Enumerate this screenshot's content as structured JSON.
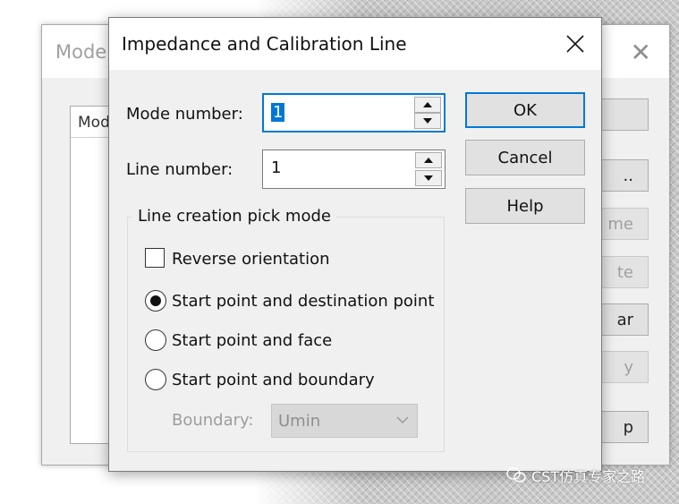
{
  "back_dialog": {
    "title_partial": "Mode",
    "list_header_partial": "Mod",
    "buttons": [
      "",
      "..",
      "me",
      "te",
      "ar",
      "y",
      "p"
    ]
  },
  "dialog": {
    "title": "Impedance and Calibration Line",
    "mode_number_label": "Mode number:",
    "mode_number_value": "1",
    "line_number_label": "Line number:",
    "line_number_value": "1",
    "ok_label": "OK",
    "cancel_label": "Cancel",
    "help_label": "Help",
    "group_label": "Line creation pick mode",
    "reverse_label": "Reverse orientation",
    "reverse_checked": false,
    "options": [
      {
        "label": "Start point and destination point",
        "selected": true
      },
      {
        "label": "Start point and face",
        "selected": false
      },
      {
        "label": "Start point and boundary",
        "selected": false
      }
    ],
    "boundary_label": "Boundary:",
    "boundary_value": "Umin"
  },
  "watermark": "CST仿真专家之路",
  "colors": {
    "accent": "#0078d7",
    "dialog_bg": "#f0f0f0",
    "button_bg": "#e1e1e1"
  }
}
